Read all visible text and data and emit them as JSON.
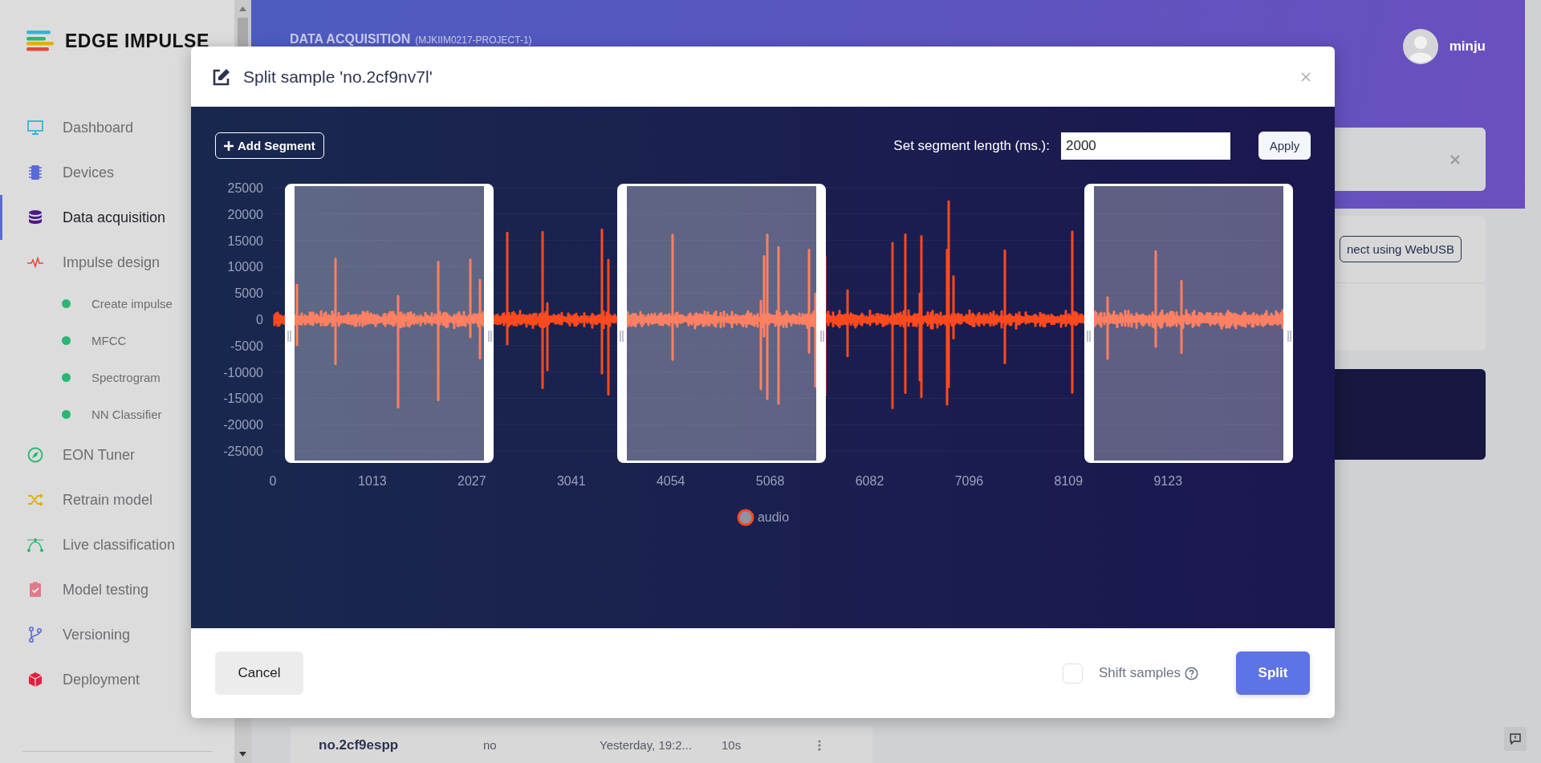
{
  "sidebar": {
    "logo": "EDGE IMPULSE",
    "items": [
      {
        "label": "Dashboard",
        "selected": false
      },
      {
        "label": "Devices",
        "selected": false
      },
      {
        "label": "Data acquisition",
        "selected": true
      },
      {
        "label": "Impulse design",
        "selected": false,
        "children": [
          {
            "label": "Create impulse",
            "selected": false
          },
          {
            "label": "MFCC",
            "selected": false
          },
          {
            "label": "Spectrogram",
            "selected": false
          },
          {
            "label": "NN Classifier",
            "selected": false
          }
        ]
      },
      {
        "label": "EON Tuner",
        "selected": false
      },
      {
        "label": "Retrain model",
        "selected": false
      },
      {
        "label": "Live classification",
        "selected": false
      },
      {
        "label": "Model testing",
        "selected": false
      },
      {
        "label": "Versioning",
        "selected": false
      },
      {
        "label": "Deployment",
        "selected": false
      }
    ]
  },
  "header": {
    "title": "DATA ACQUISITION",
    "project": "(MJKIIM0217-PROJECT-1)",
    "user": "minju"
  },
  "background": {
    "webusb_button": "nect using WebUSB",
    "table_row": {
      "name": "no.2cf9espp",
      "label": "no",
      "added": "Yesterday, 19:2...",
      "length": "10s"
    }
  },
  "modal": {
    "title": "Split sample 'no.2cf9nv7l'",
    "add_segment": "Add Segment",
    "length_label": "Set segment length (ms.):",
    "length_value": "2000",
    "apply": "Apply",
    "chart": {
      "y_ticks": [
        "25000",
        "20000",
        "15000",
        "10000",
        "5000",
        "0",
        "-5000",
        "-10000",
        "-15000",
        "-20000",
        "-25000"
      ],
      "x_ticks": [
        "0",
        "1013",
        "2027",
        "3041",
        "4054",
        "5068",
        "6082",
        "7096",
        "8109",
        "9123"
      ],
      "legend": "audio"
    },
    "cancel": "Cancel",
    "shift_samples": {
      "label": "Shift samples",
      "checked": false
    },
    "split": "Split"
  }
}
